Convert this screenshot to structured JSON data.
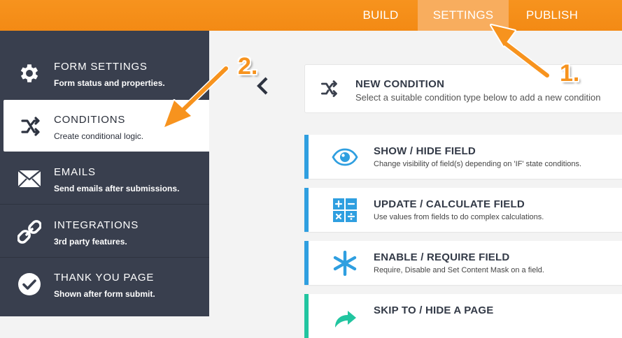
{
  "header": {
    "tabs": [
      {
        "label": "BUILD"
      },
      {
        "label": "SETTINGS",
        "active": true
      },
      {
        "label": "PUBLISH"
      }
    ]
  },
  "sidebar": {
    "items": [
      {
        "title": "FORM SETTINGS",
        "subtitle": "Form status and properties.",
        "icon": "gear-icon"
      },
      {
        "title": "CONDITIONS",
        "subtitle": "Create conditional logic.",
        "icon": "conditions-icon",
        "active": true
      },
      {
        "title": "EMAILS",
        "subtitle": "Send emails after submissions.",
        "icon": "envelope-icon"
      },
      {
        "title": "INTEGRATIONS",
        "subtitle": "3rd party features.",
        "icon": "link-icon"
      },
      {
        "title": "THANK YOU PAGE",
        "subtitle": "Shown after form submit.",
        "icon": "check-circle-icon"
      }
    ]
  },
  "main": {
    "new_condition": {
      "title": "NEW CONDITION",
      "subtitle": "Select a suitable condition type below to add a new condition"
    },
    "conditions": [
      {
        "title": "SHOW / HIDE FIELD",
        "subtitle": "Change visibility of field(s) depending on 'IF' state conditions.",
        "icon": "eye-icon",
        "color": "#2f9fe0"
      },
      {
        "title": "UPDATE / CALCULATE FIELD",
        "subtitle": "Use values from fields to do complex calculations.",
        "icon": "calculator-icon",
        "color": "#2f9fe0"
      },
      {
        "title": "ENABLE / REQUIRE FIELD",
        "subtitle": "Require, Disable and Set Content Mask on a field.",
        "icon": "asterisk-icon",
        "color": "#2f9fe0"
      },
      {
        "title": "SKIP TO / HIDE A PAGE",
        "subtitle": "",
        "icon": "skip-arrow-icon",
        "color": "#21c5a0"
      }
    ]
  },
  "annotations": {
    "step1": "1.",
    "step2": "2."
  },
  "colors": {
    "brand_orange": "#f7931e",
    "sidebar_dark": "#393f4e",
    "accent_blue": "#2f9fe0",
    "accent_teal": "#21c5a0"
  }
}
